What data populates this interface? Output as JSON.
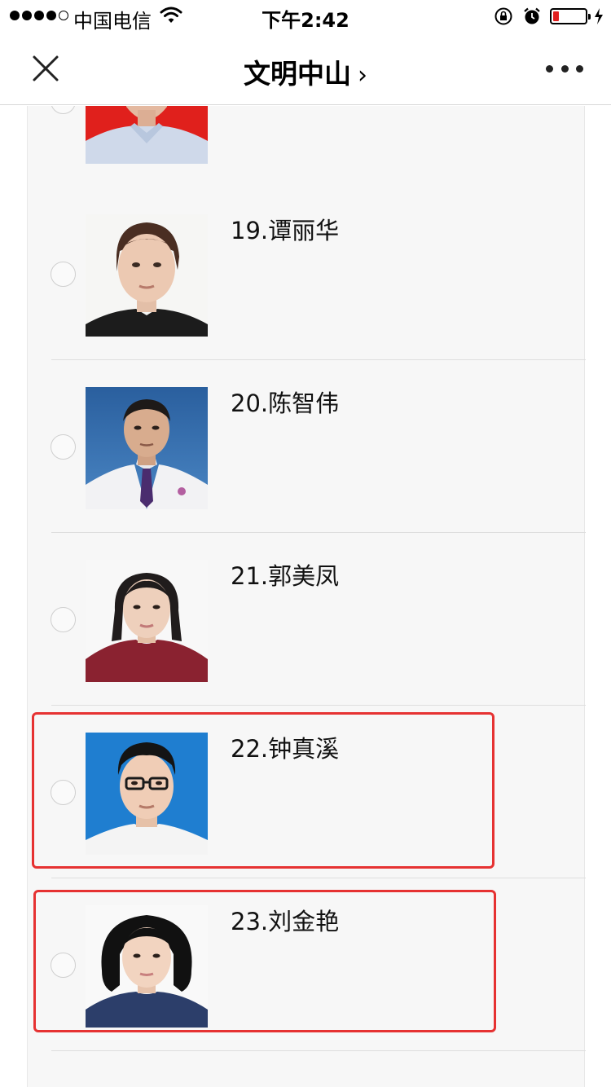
{
  "status_bar": {
    "carrier": "中国电信",
    "time": "下午2:42"
  },
  "nav": {
    "title": "文明中山",
    "chevron": "›"
  },
  "candidates": [
    {
      "name": "19.谭丽华"
    },
    {
      "name": "20.陈智伟"
    },
    {
      "name": "21.郭美凤"
    },
    {
      "name": "22.钟真溪"
    },
    {
      "name": "23.刘金艳"
    }
  ],
  "colors": {
    "highlight": "#e63232",
    "battery_low": "#e02020"
  },
  "icons": [
    "close-icon",
    "more-icon",
    "wifi-icon",
    "orientation-lock-icon",
    "alarm-icon",
    "battery-icon",
    "charging-icon"
  ]
}
